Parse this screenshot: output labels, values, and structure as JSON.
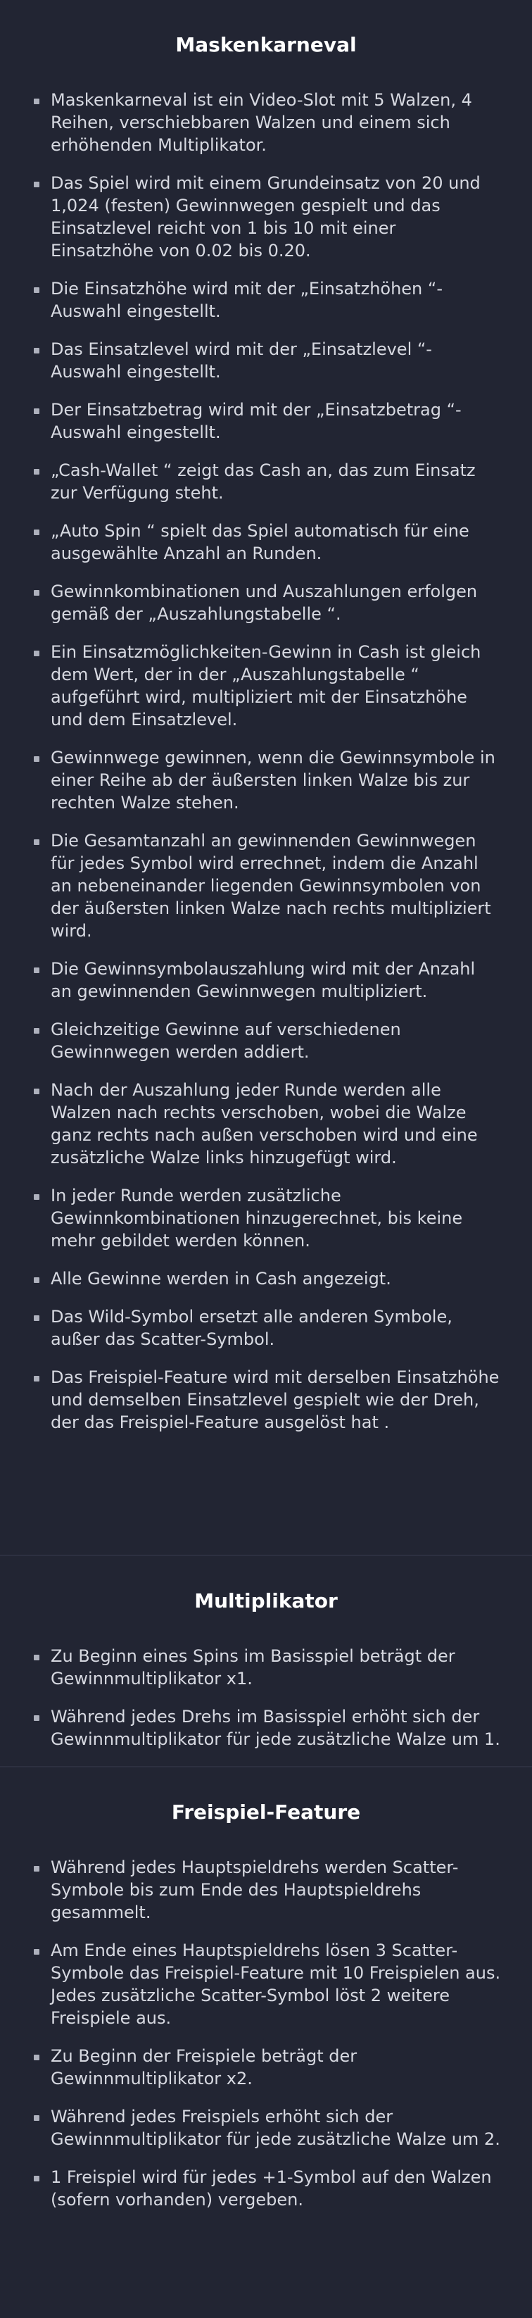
{
  "sections": [
    {
      "title": "Maskenkarneval",
      "items": [
        "Maskenkarneval ist ein Video-Slot mit 5 Walzen, 4 Reihen, verschiebbaren Walzen und einem sich erhöhenden Multiplikator.",
        "Das Spiel wird mit einem Grundeinsatz von 20 und 1,024 (festen) Gewinnwegen gespielt und das Einsatzlevel reicht von 1 bis 10 mit einer Einsatzhöhe von 0.02 bis 0.20.",
        "Die Einsatzhöhe wird mit der „Einsatzhöhen “-Auswahl eingestellt.",
        "Das Einsatzlevel wird mit der „Einsatzlevel “-Auswahl eingestellt.",
        "Der Einsatzbetrag wird mit der „Einsatzbetrag “-Auswahl eingestellt.",
        "„Cash-Wallet “ zeigt das Cash an, das zum Einsatz zur Verfügung steht.",
        "„Auto Spin “ spielt das Spiel automatisch für eine ausgewählte Anzahl an Runden.",
        "Gewinnkombinationen und Auszahlungen erfolgen gemäß der „Auszahlungstabelle “.",
        "Ein Einsatzmöglichkeiten-Gewinn in Cash ist gleich dem Wert, der in der „Auszahlungstabelle “ aufgeführt wird, multipliziert mit der Einsatzhöhe und dem Einsatzlevel.",
        "Gewinnwege gewinnen, wenn die Gewinnsymbole in einer Reihe ab der äußersten linken Walze bis zur rechten Walze stehen.",
        "Die Gesamtanzahl an gewinnenden Gewinnwegen für jedes Symbol wird errechnet, indem die Anzahl an nebeneinander liegenden Gewinnsymbolen von der äußersten linken Walze nach rechts multipliziert wird.",
        "Die Gewinnsymbolauszahlung wird mit der Anzahl an gewinnenden Gewinnwegen multipliziert.",
        "Gleichzeitige Gewinne auf verschiedenen Gewinnwegen werden addiert.",
        "Nach der Auszahlung jeder Runde werden alle Walzen nach rechts verschoben, wobei die Walze ganz rechts nach außen verschoben wird und eine zusätzliche Walze links hinzugefügt wird.",
        "In jeder Runde werden zusätzliche Gewinnkombinationen hinzugerechnet, bis keine mehr gebildet werden können.",
        "Alle Gewinne werden in Cash angezeigt.",
        "Das Wild-Symbol ersetzt alle anderen Symbole, außer das Scatter-Symbol.",
        "Das Freispiel-Feature wird mit derselben Einsatzhöhe und demselben Einsatzlevel gespielt wie der Dreh, der das Freispiel-Feature ausgelöst hat ."
      ]
    },
    {
      "title": "Multiplikator",
      "items": [
        "Zu Beginn eines Spins im Basisspiel beträgt der Gewinnmultiplikator x1.",
        "Während jedes Drehs im Basisspiel erhöht sich der Gewinnmultiplikator für jede zusätzliche Walze um 1."
      ]
    },
    {
      "title": "Freispiel-Feature",
      "items": [
        "Während jedes Hauptspieldrehs werden Scatter-Symbole bis zum Ende des Hauptspieldrehs gesammelt.",
        "Am Ende eines Hauptspieldrehs lösen 3 Scatter-Symbole das Freispiel-Feature mit 10 Freispielen aus. Jedes zusätzliche Scatter-Symbol löst 2 weitere Freispiele aus.",
        "Zu Beginn der Freispiele beträgt der Gewinnmultiplikator x2.",
        "Während jedes Freispiels erhöht sich der Gewinnmultiplikator für jede zusätzliche Walze um 2.",
        "1 Freispiel wird für jedes +1-Symbol auf den Walzen (sofern vorhanden) vergeben."
      ]
    }
  ]
}
